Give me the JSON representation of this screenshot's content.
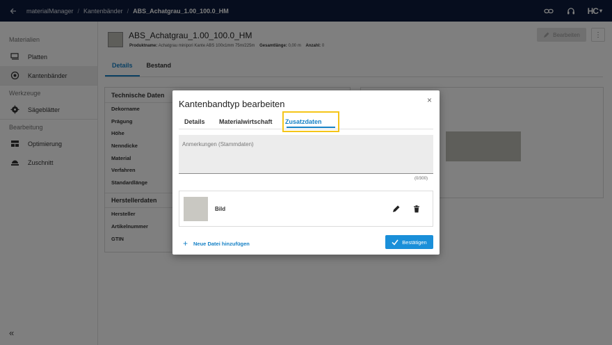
{
  "topbar": {
    "back_icon": "arrow-left-icon",
    "breadcrumbs": [
      "materialManager",
      "Kantenbänder",
      "ABS_Achatgrau_1.00_100.0_HM"
    ],
    "separator": "/",
    "icons": [
      "link-icon",
      "headset-support-icon"
    ],
    "brand": "HC",
    "brand_caret": "▾"
  },
  "sidebar": {
    "sections": [
      {
        "label": "Materialien",
        "items": [
          {
            "label": "Platten",
            "icon": "panel-icon"
          },
          {
            "label": "Kantenbänder",
            "icon": "edgeband-roll-icon",
            "active": true
          }
        ]
      },
      {
        "label": "Werkzeuge",
        "items": [
          {
            "label": "Sägeblätter",
            "icon": "sawblade-icon"
          }
        ]
      },
      {
        "label": "Bearbeitung",
        "items": [
          {
            "label": "Optimierung",
            "icon": "optimization-icon"
          },
          {
            "label": "Zuschnitt",
            "icon": "cutting-icon"
          }
        ]
      }
    ],
    "collapse_label": "«"
  },
  "main": {
    "title": "ABS_Achatgrau_1.00_100.0_HM",
    "product_name_label": "Produktname:",
    "product_name_value": "Achatgrau minipori Kante ABS 100x1mm 75m/225m",
    "total_length_label": "Gesamtlänge:",
    "total_length_value": "0,00 m",
    "count_label": "Anzahl:",
    "count_value": "0",
    "edit_button": "Bearbeiten",
    "more_button": "⋮",
    "tabs": [
      "Details",
      "Bestand"
    ],
    "tech_header": "Technische Daten",
    "tech_props": [
      "Dekorname",
      "Prägung",
      "Höhe",
      "Nenndicke",
      "Material",
      "Verfahren",
      "Standardlänge"
    ],
    "manufacturer_header": "Herstellerdaten",
    "manufacturer_props": [
      "Hersteller",
      "Artikelnummer",
      "GTIN"
    ]
  },
  "dialog": {
    "title": "Kantenbandtyp bearbeiten",
    "close": "×",
    "tabs": [
      "Details",
      "Materialwirtschaft",
      "Zusatzdaten"
    ],
    "active_tab": "Zusatzdaten",
    "notes_placeholder": "Anmerkungen (Stammdaten)",
    "notes_counter": "(0/300)",
    "file_label": "Bild",
    "add_file": "Neue Datei hinzufügen",
    "confirm": "Bestätigen"
  },
  "colors": {
    "topbar": "#0c1b3c",
    "accent": "#1681c6",
    "highlight": "#f5c518",
    "confirm": "#1a8fd9"
  }
}
